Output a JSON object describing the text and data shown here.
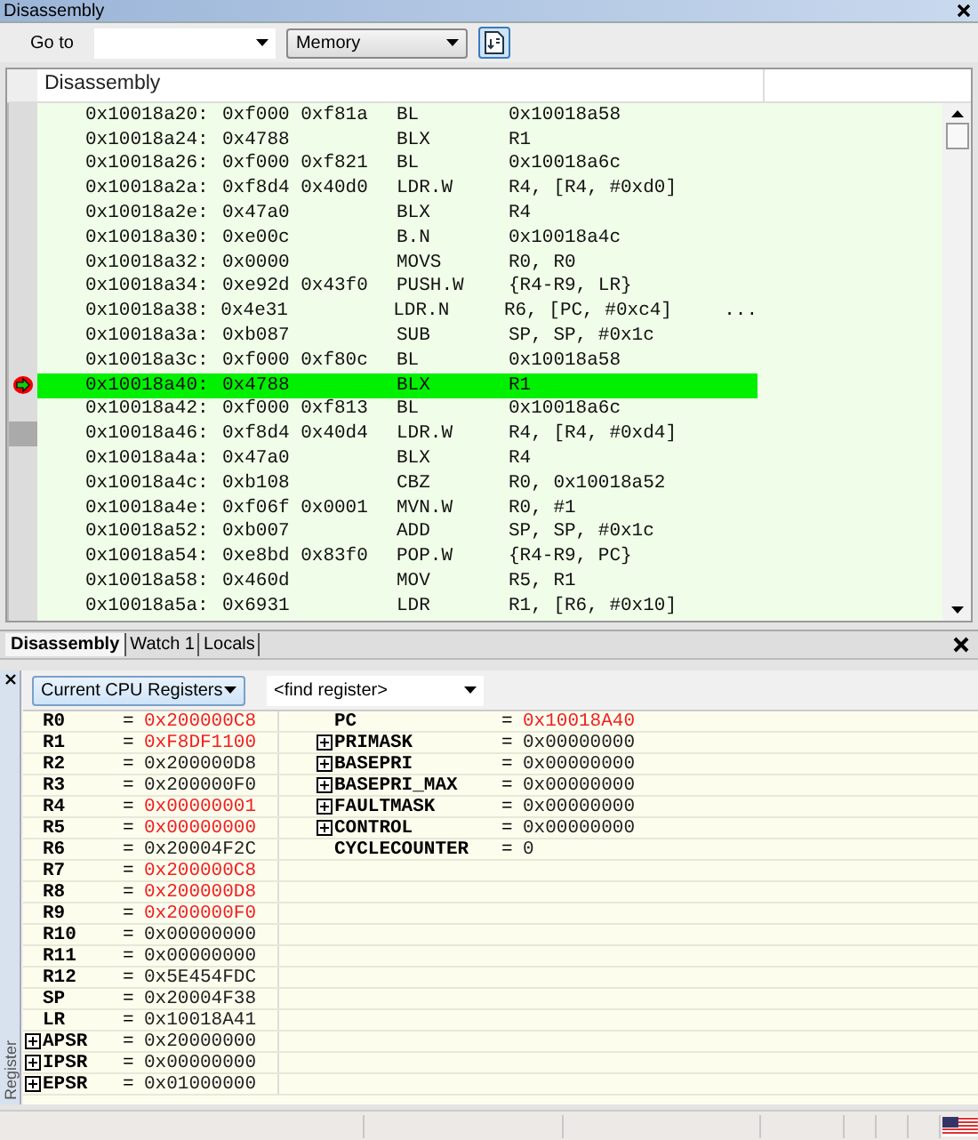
{
  "window": {
    "title": "Disassembly"
  },
  "toolbar": {
    "goto_label": "Go to",
    "memory_value": "Memory"
  },
  "disassembly": {
    "header": "Disassembly",
    "rows": [
      {
        "address": "0x10018a20:",
        "code": "0xf000 0xf81a",
        "mnemonic": "BL",
        "operands": "0x10018a58",
        "comment": "",
        "current": false,
        "gutter_mark": false
      },
      {
        "address": "0x10018a24:",
        "code": "0x4788",
        "mnemonic": "BLX",
        "operands": "R1",
        "comment": "",
        "current": false,
        "gutter_mark": false
      },
      {
        "address": "0x10018a26:",
        "code": "0xf000 0xf821",
        "mnemonic": "BL",
        "operands": "0x10018a6c",
        "comment": "",
        "current": false,
        "gutter_mark": false
      },
      {
        "address": "0x10018a2a:",
        "code": "0xf8d4 0x40d0",
        "mnemonic": "LDR.W",
        "operands": "R4, [R4, #0xd0]",
        "comment": "",
        "current": false,
        "gutter_mark": false
      },
      {
        "address": "0x10018a2e:",
        "code": "0x47a0",
        "mnemonic": "BLX",
        "operands": "R4",
        "comment": "",
        "current": false,
        "gutter_mark": false
      },
      {
        "address": "0x10018a30:",
        "code": "0xe00c",
        "mnemonic": "B.N",
        "operands": "0x10018a4c",
        "comment": "",
        "current": false,
        "gutter_mark": false
      },
      {
        "address": "0x10018a32:",
        "code": "0x0000",
        "mnemonic": "MOVS",
        "operands": "R0, R0",
        "comment": "",
        "current": false,
        "gutter_mark": false
      },
      {
        "address": "0x10018a34:",
        "code": "0xe92d 0x43f0",
        "mnemonic": "PUSH.W",
        "operands": "{R4-R9, LR}",
        "comment": "",
        "current": false,
        "gutter_mark": false
      },
      {
        "address": "0x10018a38:",
        "code": "0x4e31",
        "mnemonic": "LDR.N",
        "operands": "R6, [PC, #0xc4]",
        "comment": "...",
        "current": false,
        "gutter_mark": false
      },
      {
        "address": "0x10018a3a:",
        "code": "0xb087",
        "mnemonic": "SUB",
        "operands": "SP, SP, #0x1c",
        "comment": "",
        "current": false,
        "gutter_mark": false
      },
      {
        "address": "0x10018a3c:",
        "code": "0xf000 0xf80c",
        "mnemonic": "BL",
        "operands": "0x10018a58",
        "comment": "",
        "current": false,
        "gutter_mark": false
      },
      {
        "address": "0x10018a40:",
        "code": "0x4788",
        "mnemonic": "BLX",
        "operands": "R1",
        "comment": "",
        "current": true,
        "gutter_mark": false
      },
      {
        "address": "0x10018a42:",
        "code": "0xf000 0xf813",
        "mnemonic": "BL",
        "operands": "0x10018a6c",
        "comment": "",
        "current": false,
        "gutter_mark": false
      },
      {
        "address": "0x10018a46:",
        "code": "0xf8d4 0x40d4",
        "mnemonic": "LDR.W",
        "operands": "R4, [R4, #0xd4]",
        "comment": "",
        "current": false,
        "gutter_mark": true
      },
      {
        "address": "0x10018a4a:",
        "code": "0x47a0",
        "mnemonic": "BLX",
        "operands": "R4",
        "comment": "",
        "current": false,
        "gutter_mark": false
      },
      {
        "address": "0x10018a4c:",
        "code": "0xb108",
        "mnemonic": "CBZ",
        "operands": "R0, 0x10018a52",
        "comment": "",
        "current": false,
        "gutter_mark": false
      },
      {
        "address": "0x10018a4e:",
        "code": "0xf06f 0x0001",
        "mnemonic": "MVN.W",
        "operands": "R0, #1",
        "comment": "",
        "current": false,
        "gutter_mark": false
      },
      {
        "address": "0x10018a52:",
        "code": "0xb007",
        "mnemonic": "ADD",
        "operands": "SP, SP, #0x1c",
        "comment": "",
        "current": false,
        "gutter_mark": false
      },
      {
        "address": "0x10018a54:",
        "code": "0xe8bd 0x83f0",
        "mnemonic": "POP.W",
        "operands": "{R4-R9, PC}",
        "comment": "",
        "current": false,
        "gutter_mark": false
      },
      {
        "address": "0x10018a58:",
        "code": "0x460d",
        "mnemonic": "MOV",
        "operands": "R5, R1",
        "comment": "",
        "current": false,
        "gutter_mark": false
      },
      {
        "address": "0x10018a5a:",
        "code": "0x6931",
        "mnemonic": "LDR",
        "operands": "R1, [R6, #0x10]",
        "comment": "",
        "current": false,
        "gutter_mark": false
      }
    ]
  },
  "tabs": [
    {
      "label": "Disassembly",
      "selected": true
    },
    {
      "label": "Watch 1",
      "selected": false
    },
    {
      "label": "Locals",
      "selected": false
    }
  ],
  "registers": {
    "side_tab": "Register",
    "group_value": "Current CPU Registers",
    "find_placeholder": "<find register>",
    "left": [
      {
        "name": "R0",
        "eq": "=",
        "value": "0x200000C8",
        "changed": true,
        "expandable": false
      },
      {
        "name": "R1",
        "eq": "=",
        "value": "0xF8DF1100",
        "changed": true,
        "expandable": false
      },
      {
        "name": "R2",
        "eq": "=",
        "value": "0x200000D8",
        "changed": false,
        "expandable": false
      },
      {
        "name": "R3",
        "eq": "=",
        "value": "0x200000F0",
        "changed": false,
        "expandable": false
      },
      {
        "name": "R4",
        "eq": "=",
        "value": "0x00000001",
        "changed": true,
        "expandable": false
      },
      {
        "name": "R5",
        "eq": "=",
        "value": "0x00000000",
        "changed": true,
        "expandable": false
      },
      {
        "name": "R6",
        "eq": "=",
        "value": "0x20004F2C",
        "changed": false,
        "expandable": false
      },
      {
        "name": "R7",
        "eq": "=",
        "value": "0x200000C8",
        "changed": true,
        "expandable": false
      },
      {
        "name": "R8",
        "eq": "=",
        "value": "0x200000D8",
        "changed": true,
        "expandable": false
      },
      {
        "name": "R9",
        "eq": "=",
        "value": "0x200000F0",
        "changed": true,
        "expandable": false
      },
      {
        "name": "R10",
        "eq": "=",
        "value": "0x00000000",
        "changed": false,
        "expandable": false
      },
      {
        "name": "R11",
        "eq": "=",
        "value": "0x00000000",
        "changed": false,
        "expandable": false
      },
      {
        "name": "R12",
        "eq": "=",
        "value": "0x5E454FDC",
        "changed": false,
        "expandable": false
      },
      {
        "name": "SP",
        "eq": "=",
        "value": "0x20004F38",
        "changed": false,
        "expandable": false
      },
      {
        "name": "LR",
        "eq": "=",
        "value": "0x10018A41",
        "changed": false,
        "expandable": false
      },
      {
        "name": "APSR",
        "eq": "=",
        "value": "0x20000000",
        "changed": false,
        "expandable": true
      },
      {
        "name": "IPSR",
        "eq": "=",
        "value": "0x00000000",
        "changed": false,
        "expandable": true
      },
      {
        "name": "EPSR",
        "eq": "=",
        "value": "0x01000000",
        "changed": false,
        "expandable": true
      }
    ],
    "right": [
      {
        "name": "PC",
        "eq": "=",
        "value": "0x10018A40",
        "changed": true,
        "expandable": false
      },
      {
        "name": "PRIMASK",
        "eq": "=",
        "value": "0x00000000",
        "changed": false,
        "expandable": true
      },
      {
        "name": "BASEPRI",
        "eq": "=",
        "value": "0x00000000",
        "changed": false,
        "expandable": true
      },
      {
        "name": "BASEPRI_MAX",
        "eq": "=",
        "value": "0x00000000",
        "changed": false,
        "expandable": true
      },
      {
        "name": "FAULTMASK",
        "eq": "=",
        "value": "0x00000000",
        "changed": false,
        "expandable": true
      },
      {
        "name": "CONTROL",
        "eq": "=",
        "value": "0x00000000",
        "changed": false,
        "expandable": true
      },
      {
        "name": "CYCLECOUNTER",
        "eq": "=",
        "value": "0",
        "changed": false,
        "expandable": false
      }
    ]
  }
}
